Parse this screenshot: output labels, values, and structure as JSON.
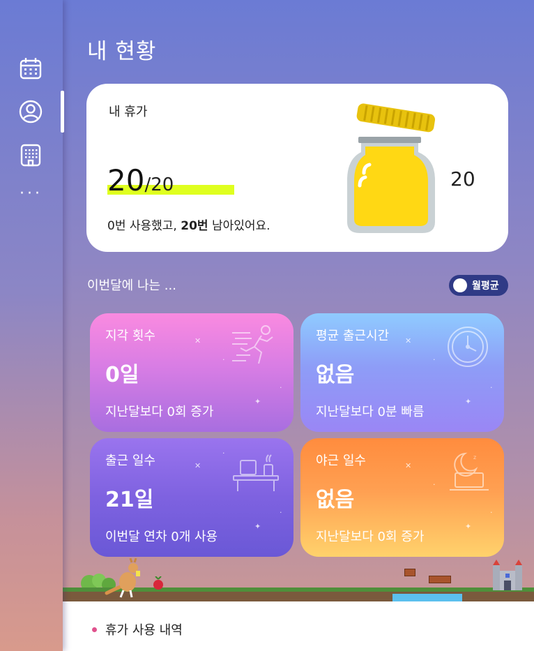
{
  "sidebar": {
    "items": [
      {
        "name": "calendar",
        "icon": "calendar-icon"
      },
      {
        "name": "profile",
        "icon": "user-icon",
        "active": true
      },
      {
        "name": "building",
        "icon": "building-icon"
      }
    ],
    "more_label": "···"
  },
  "page": {
    "title": "내 현황"
  },
  "vacation": {
    "label": "내 휴가",
    "remaining": "20",
    "total": "/20",
    "desc_prefix": "0번 사용했고, ",
    "desc_bold": "20번",
    "desc_suffix": " 남아있어요.",
    "jar_count": "20"
  },
  "month": {
    "label": "이번달에 나는 ...",
    "toggle_label": "월평균"
  },
  "stats": [
    {
      "title": "지각 횟수",
      "value": "0일",
      "sub": "지난달보다 0회 증가",
      "icon": "running-person-icon"
    },
    {
      "title": "평균 출근시간",
      "value": "없음",
      "sub": "지난달보다 0분 빠름",
      "icon": "clock-icon"
    },
    {
      "title": "출근 일수",
      "value": "21일",
      "sub": "이번달 연차 0개 사용",
      "icon": "desk-icon"
    },
    {
      "title": "야근 일수",
      "value": "없음",
      "sub": "지난달보다 0회 증가",
      "icon": "moon-laptop-icon"
    }
  ],
  "history": {
    "label": "휴가 사용 내역"
  },
  "colors": {
    "accent_highlight": "#dfff1f",
    "toggle_bg": "#2f3a86",
    "history_dot": "#e0528d",
    "jar_honey": "#ffd814"
  }
}
